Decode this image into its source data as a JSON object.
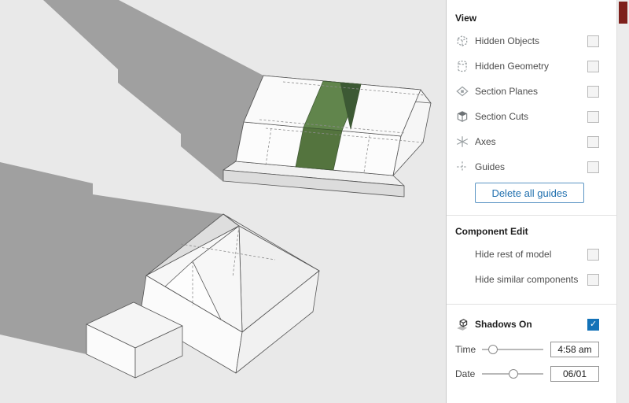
{
  "panel": {
    "view": {
      "title": "View",
      "items": [
        {
          "label": "Hidden Objects",
          "icon": "hidden-objects-icon",
          "checked": false
        },
        {
          "label": "Hidden Geometry",
          "icon": "hidden-geometry-icon",
          "checked": false
        },
        {
          "label": "Section Planes",
          "icon": "section-planes-icon",
          "checked": false
        },
        {
          "label": "Section Cuts",
          "icon": "section-cuts-icon",
          "checked": false
        },
        {
          "label": "Axes",
          "icon": "axes-icon",
          "checked": false
        },
        {
          "label": "Guides",
          "icon": "guides-icon",
          "checked": false
        }
      ],
      "button_label": "Delete all guides"
    },
    "component_edit": {
      "title": "Component Edit",
      "items": [
        {
          "label": "Hide rest of model",
          "checked": false
        },
        {
          "label": "Hide similar components",
          "checked": false
        }
      ]
    },
    "shadows": {
      "label": "Shadows On",
      "icon": "shadows-icon",
      "checked": true,
      "time_label": "Time",
      "time_value": "4:58 am",
      "time_position": "10%",
      "date_label": "Date",
      "date_value": "06/01",
      "date_position": "44%"
    }
  },
  "scene": {
    "description": "Two white 3D house models with hidden-geometry dashed lines, one with a green painted section, casting gray shadows toward upper left"
  },
  "colors": {
    "accent_blue": "#1372b8",
    "button_blue": "#1f6fae",
    "paint_green": "#5d7f49",
    "paint_green_dark": "#3c5934",
    "canvas_background": "#e9e9e9",
    "shadow_color": "#a0a0a0",
    "scrollbar_thumb_color": "#7d201b"
  }
}
